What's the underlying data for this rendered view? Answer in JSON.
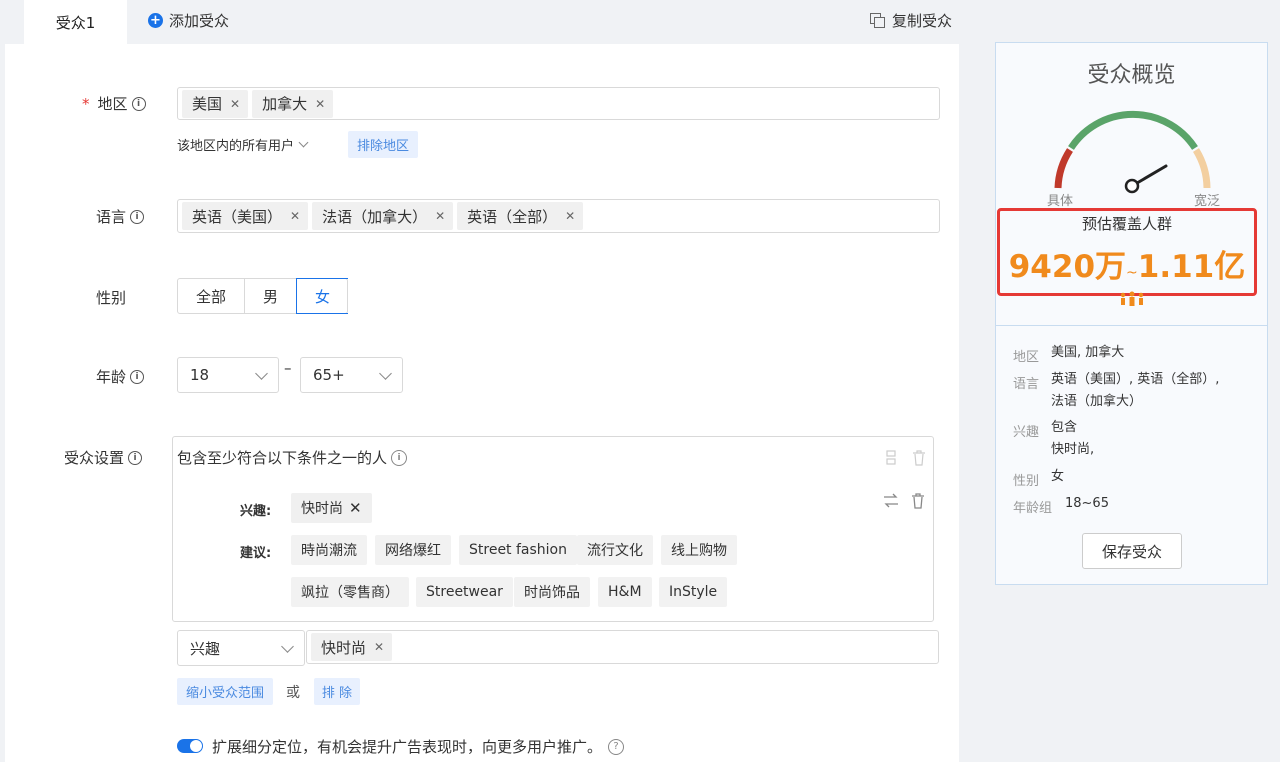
{
  "tabs": {
    "active": "受众1",
    "add": "添加受众",
    "copy": "复制受众"
  },
  "region": {
    "label": "地区",
    "tags": [
      "美国",
      "加拿大"
    ],
    "scope": "该地区内的所有用户",
    "exclude": "排除地区"
  },
  "language": {
    "label": "语言",
    "tags": [
      "英语（美国）",
      "法语（加拿大）",
      "英语（全部）"
    ]
  },
  "gender": {
    "label": "性别",
    "options": [
      "全部",
      "男",
      "女"
    ],
    "selected": "女"
  },
  "age": {
    "label": "年龄",
    "min": "18",
    "dash": "–",
    "max": "65+"
  },
  "audience": {
    "label": "受众设置",
    "desc": "包含至少符合以下条件之一的人",
    "interest_label": "兴趣:",
    "interest_tag": "快时尚",
    "suggest_label": "建议:",
    "suggestions": [
      "時尚潮流",
      "网络爆红",
      "Street fashion",
      "流行文化",
      "线上购物",
      "飒拉（零售商）",
      "Streetwear",
      "时尚饰品",
      "H&M",
      "InStyle"
    ],
    "type_select": "兴趣",
    "input_tag": "快时尚",
    "narrow": "缩小受众范围",
    "or": "或",
    "exclude": "排 除"
  },
  "expand": {
    "text": "扩展细分定位，有机会提升广告表现时，向更多用户推广。",
    "enabled": true
  },
  "overview": {
    "title": "受众概览",
    "gauge_left": "具体",
    "gauge_right": "宽泛",
    "estimate_title": "预估覆盖人群",
    "estimate_low": "9420万",
    "estimate_sep": "~",
    "estimate_high": "1.11亿",
    "summary": {
      "region_k": "地区",
      "region_v": "美国, 加拿大",
      "lang_k": "语言",
      "lang_v1": "英语（美国）, 英语（全部）,",
      "lang_v2": "法语（加拿大）",
      "interest_k": "兴趣",
      "interest_v1": "包含",
      "interest_v2": "快时尚,",
      "gender_k": "性别",
      "gender_v": "女",
      "age_k": "年龄组",
      "age_v": "18~65"
    },
    "save": "保存受众"
  },
  "colors": {
    "accent": "#1a73e8",
    "estimate": "#f08a1c",
    "highlight": "#e53935",
    "gauge_red": "#c0392b",
    "gauge_green": "#5aa469",
    "gauge_peach": "#f3cfa0"
  }
}
